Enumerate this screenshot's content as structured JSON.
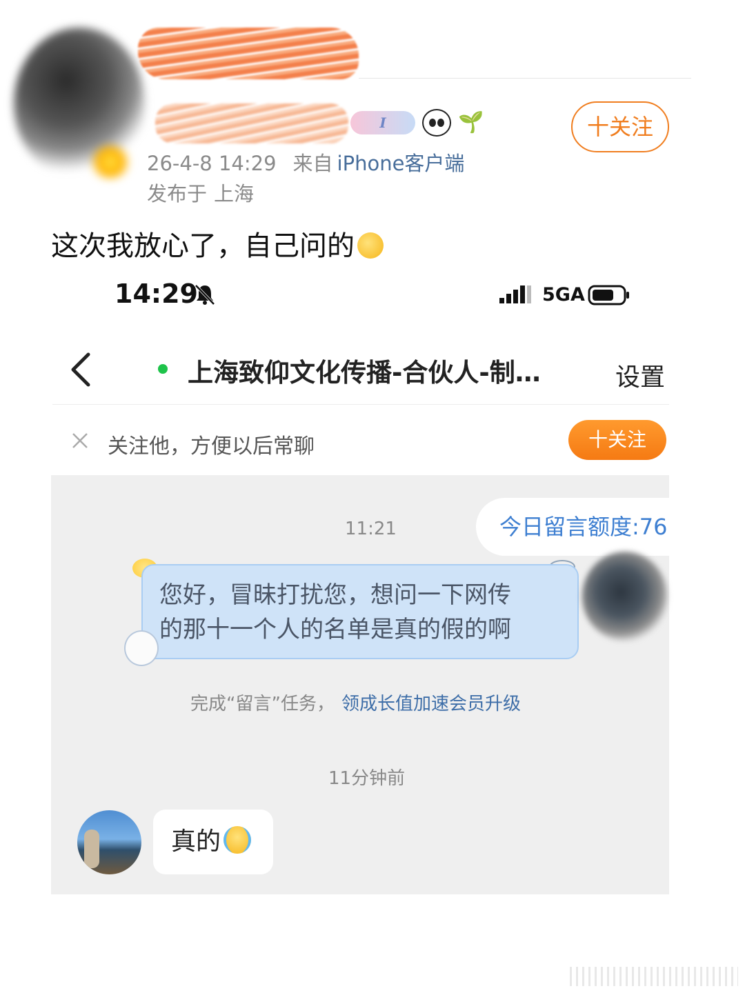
{
  "post": {
    "follow_label": "十关注",
    "date": "26-4-8 14:29",
    "source_label": "来自",
    "source_app": "iPhone客户端",
    "location_label": "发布于",
    "location": "上海",
    "text": "这次我放心了，自己问的",
    "badge_text": "I"
  },
  "phone": {
    "time": "14:29",
    "network": "5GA",
    "chat_title": "上海致仰文化传播-合伙人-制…",
    "settings_label": "设置",
    "follow_tip": "关注他，方便以后常聊",
    "follow_label": "十关注",
    "messages": {
      "time_1": "11:21",
      "quota": "今日留言额度:76",
      "sent_line_1": "您好，冒昧打扰您，想问一下网传",
      "sent_line_2": "的那十一个人的名单是真的假的啊",
      "task_prefix": "完成“留言”任务，",
      "task_link": "领成长值加速会员升级",
      "time_2": "11分钟前",
      "reply": "真的"
    }
  },
  "colors": {
    "accent_orange": "#f07d1e",
    "link_blue": "#3e7fd1",
    "online_green": "#1ec34a",
    "chat_bg": "#efefef"
  }
}
